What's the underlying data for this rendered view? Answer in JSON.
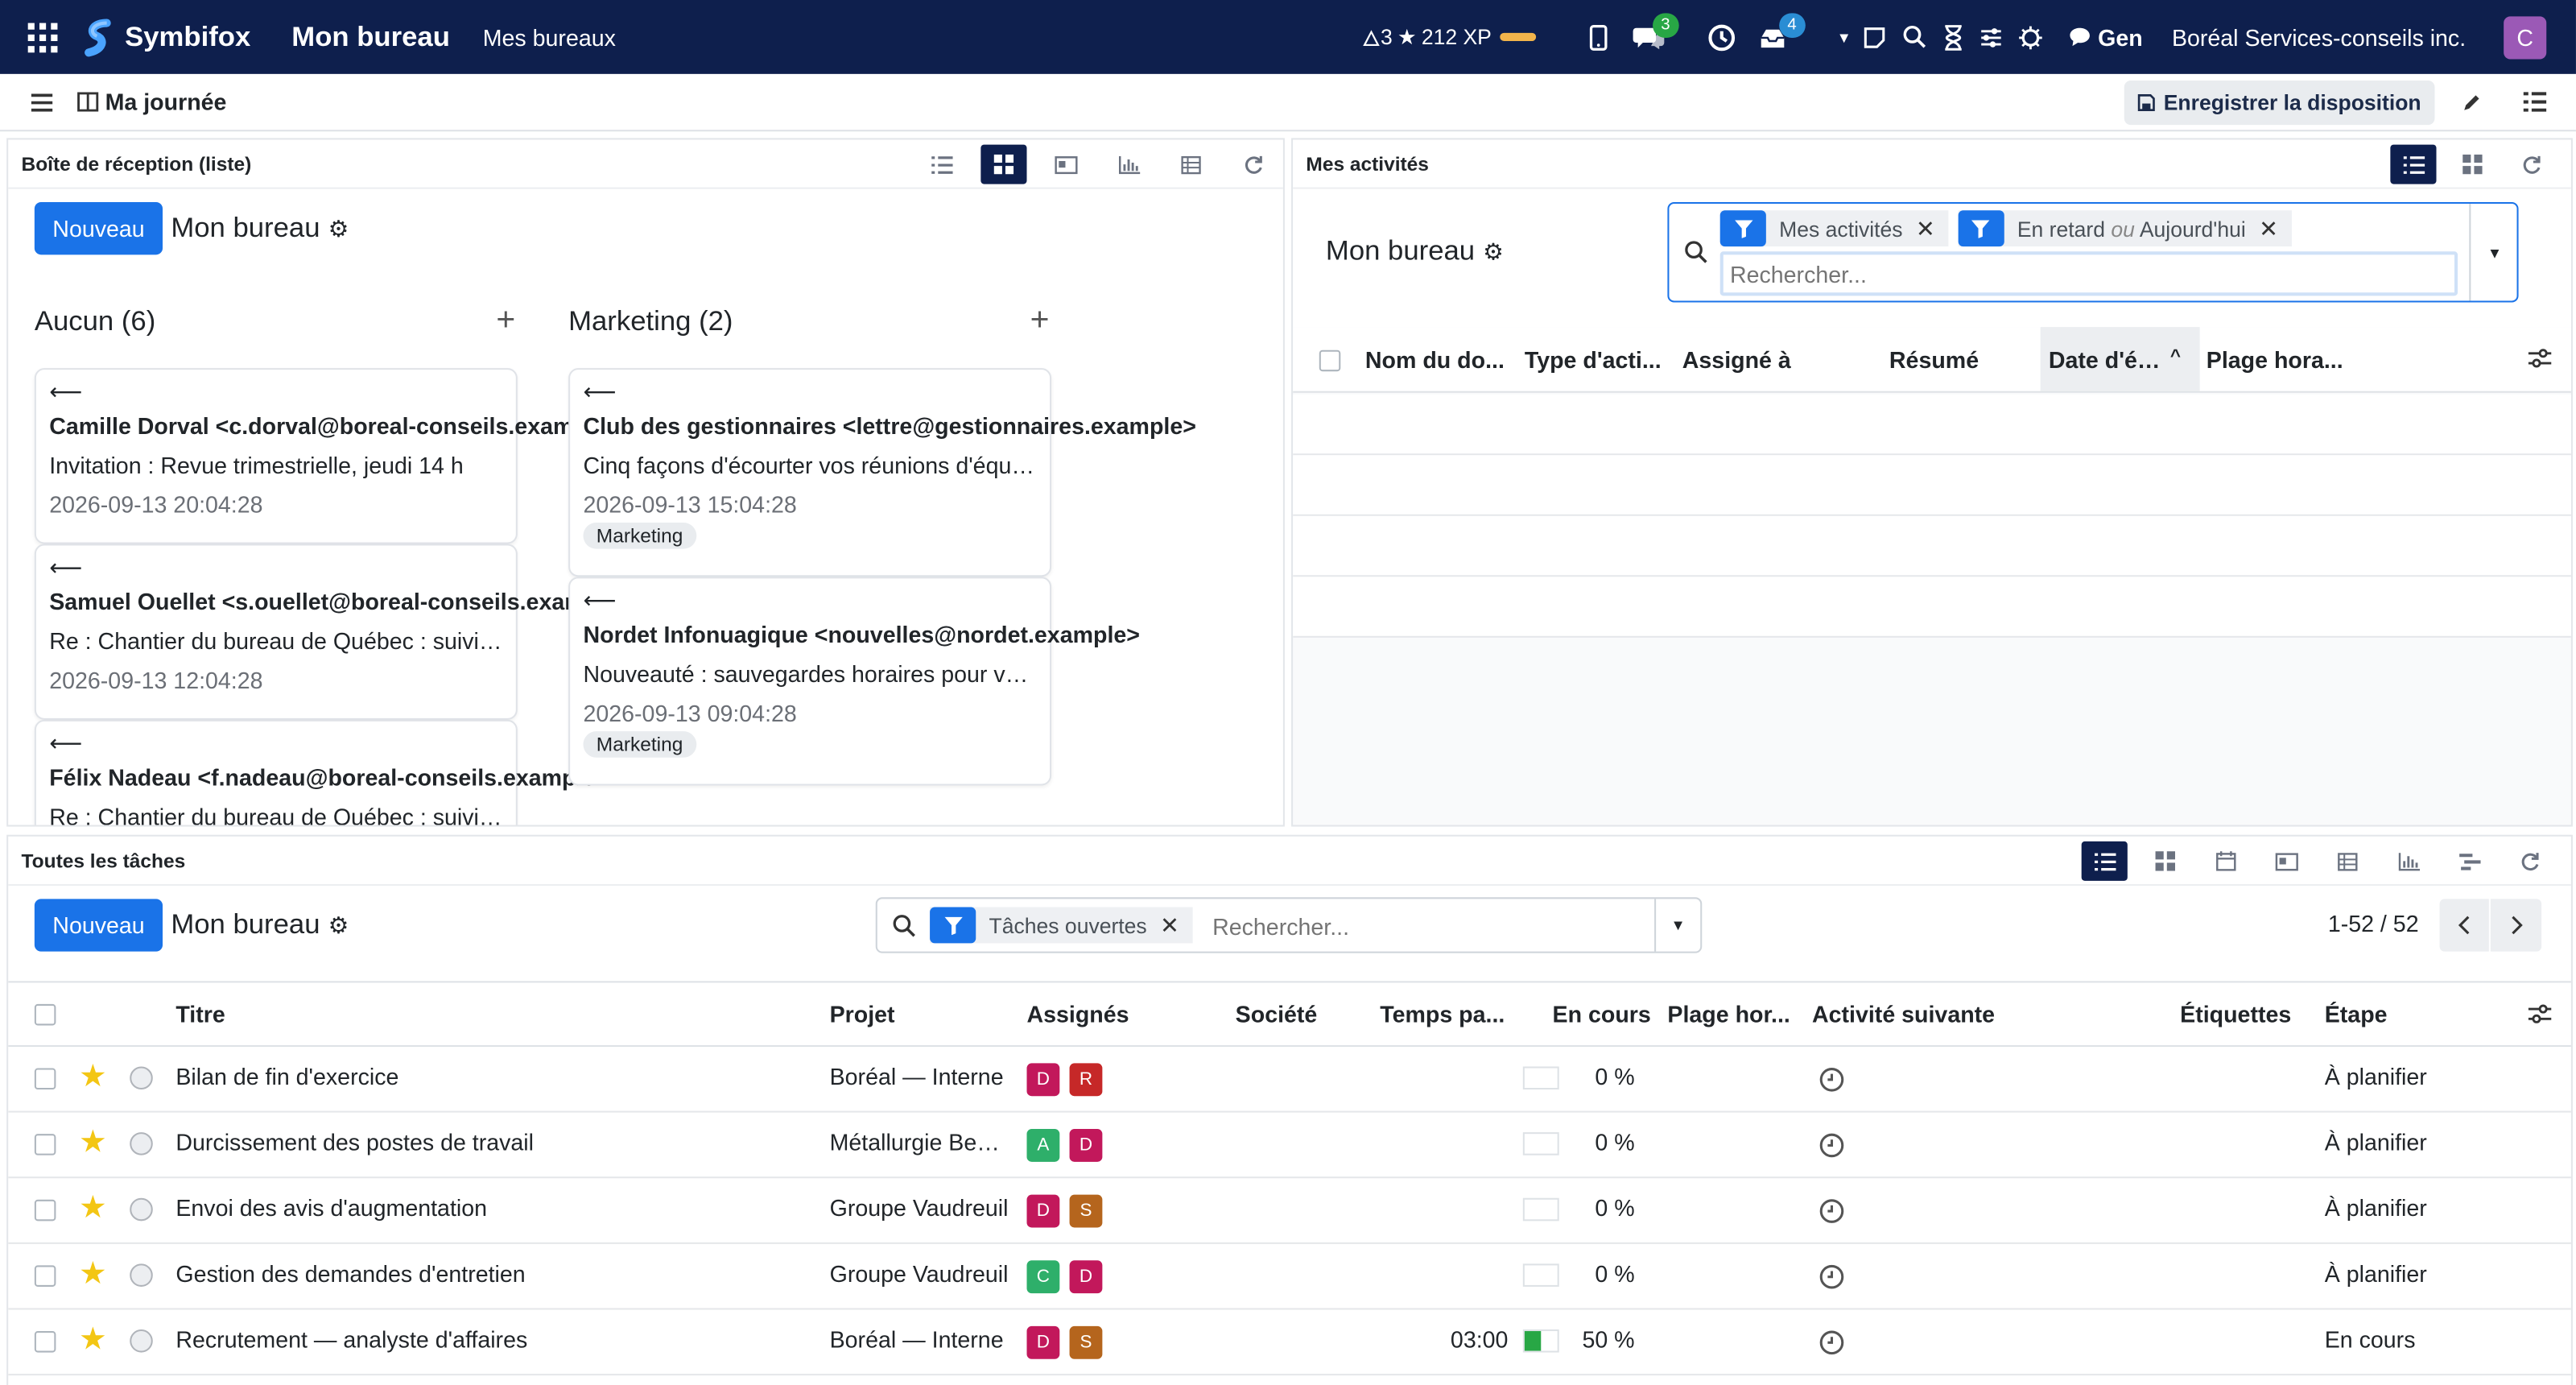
{
  "topbar": {
    "brand": "Symbifox",
    "app_title": "Mon bureau",
    "menu_item": "Mes bureaux",
    "streak": "3",
    "xp": "212 XP",
    "chat_badge": "3",
    "activity_badge": "4",
    "ai_label": "Gen",
    "company": "Boréal Services-conseils inc.",
    "user_initial": "C",
    "colors": {
      "nav_bg": "#0e1f4d",
      "accent": "#1a73e8",
      "badge_green": "#28a745",
      "badge_blue": "#2a8dd4",
      "avatar": "#9b59b6",
      "xp_bar": "#f2b44b"
    }
  },
  "subbar": {
    "my_day": "Ma journée",
    "save_layout": "Enregistrer la disposition"
  },
  "inbox": {
    "title": "Boîte de réception (liste)",
    "new_button": "Nouveau",
    "breadcrumb": "Mon bureau",
    "columns": [
      {
        "title": "Aucun (6)",
        "cards": [
          {
            "arrow": "⟵",
            "from": "Camille Dorval <c.dorval@boreal-conseils.example>",
            "subject": "Invitation : Revue trimestrielle, jeudi 14 h",
            "date": "2026-09-13 20:04:28",
            "tag": ""
          },
          {
            "arrow": "⟵",
            "from": "Samuel Ouellet <s.ouellet@boreal-conseils.example>",
            "subject": "Re : Chantier du bureau de Québec : suivi des travaux",
            "date": "2026-09-13 12:04:28",
            "tag": ""
          },
          {
            "arrow": "⟵",
            "from": "Félix Nadeau <f.nadeau@boreal-conseils.example>",
            "subject": "Re : Chantier du bureau de Québec : suivi des travaux",
            "date": "",
            "tag": ""
          }
        ]
      },
      {
        "title": "Marketing (2)",
        "cards": [
          {
            "arrow": "⟵",
            "from": "Club des gestionnaires <lettre@gestionnaires.example>",
            "subject": "Cinq façons d'écourter vos réunions d'équipe",
            "date": "2026-09-13 15:04:28",
            "tag": "Marketing"
          },
          {
            "arrow": "⟵",
            "from": "Nordet Infonuagique <nouvelles@nordet.example>",
            "subject": "Nouveauté : sauvegardes horaires pour vos serveurs",
            "date": "2026-09-13 09:04:28",
            "tag": "Marketing"
          }
        ]
      }
    ]
  },
  "activities": {
    "title": "Mes activités",
    "breadcrumb": "Mon bureau",
    "facets": [
      {
        "label": "Mes activités"
      },
      {
        "label_a": "En retard",
        "or": "ou",
        "label_b": "Aujourd'hui"
      }
    ],
    "search_placeholder": "Rechercher...",
    "columns": [
      "Nom du do...",
      "Type d'acti...",
      "Assigné à",
      "Résumé",
      "Date d'éc...",
      "Plage hora..."
    ]
  },
  "tasks": {
    "title": "Toutes les tâches",
    "new_button": "Nouveau",
    "breadcrumb": "Mon bureau",
    "facet": "Tâches ouvertes",
    "search_placeholder": "Rechercher...",
    "pager": "1-52 / 52",
    "columns": {
      "title": "Titre",
      "project": "Projet",
      "assignees": "Assignés",
      "company": "Société",
      "time": "Temps pa...",
      "progress": "En cours",
      "slot": "Plage hor...",
      "next_activity": "Activité suivante",
      "tags": "Étiquettes",
      "stage": "Étape"
    },
    "rows": [
      {
        "title": "Bilan de fin d'exercice",
        "project": "Boréal — Interne",
        "assignees": [
          {
            "i": "D",
            "color": "#c2185b"
          },
          {
            "i": "R",
            "color": "#c62828"
          }
        ],
        "time": "",
        "progress": "0 %",
        "progress_value": 0,
        "stage": "À planifier"
      },
      {
        "title": "Durcissement des postes de travail",
        "project": "Métallurgie Beauce",
        "assignees": [
          {
            "i": "A",
            "color": "#2eaf6a"
          },
          {
            "i": "D",
            "color": "#c2185b"
          }
        ],
        "time": "",
        "progress": "0 %",
        "progress_value": 0,
        "stage": "À planifier"
      },
      {
        "title": "Envoi des avis d'augmentation",
        "project": "Groupe Vaudreuil",
        "assignees": [
          {
            "i": "D",
            "color": "#c2185b"
          },
          {
            "i": "S",
            "color": "#b5651d"
          }
        ],
        "time": "",
        "progress": "0 %",
        "progress_value": 0,
        "stage": "À planifier"
      },
      {
        "title": "Gestion des demandes d'entretien",
        "project": "Groupe Vaudreuil",
        "assignees": [
          {
            "i": "C",
            "color": "#2eaf6a"
          },
          {
            "i": "D",
            "color": "#c2185b"
          }
        ],
        "time": "",
        "progress": "0 %",
        "progress_value": 0,
        "stage": "À planifier"
      },
      {
        "title": "Recrutement — analyste d'affaires",
        "project": "Boréal — Interne",
        "assignees": [
          {
            "i": "D",
            "color": "#c2185b"
          },
          {
            "i": "S",
            "color": "#b5651d"
          }
        ],
        "time": "03:00",
        "progress": "50 %",
        "progress_value": 50,
        "stage": "En cours"
      }
    ]
  }
}
